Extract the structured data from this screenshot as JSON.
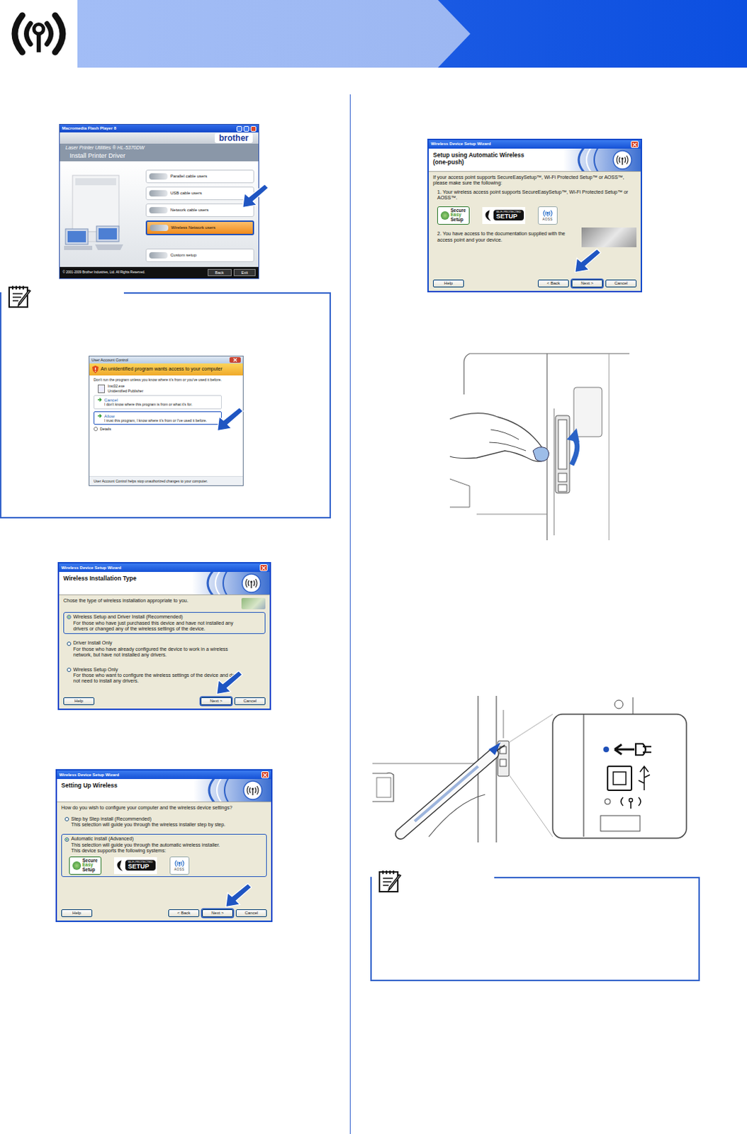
{
  "installer": {
    "title": "Macromedia Flash Player 8",
    "brand": "brother",
    "product": "Laser Printer Utilities ® HL-5370DW",
    "heading": "Install Printer Driver",
    "options": [
      {
        "label": "Parallel cable users",
        "kind": "connection",
        "selected": false
      },
      {
        "label": "USB cable users",
        "kind": "connection",
        "selected": false
      },
      {
        "label": "Network cable users",
        "kind": "connection",
        "selected": false
      },
      {
        "label": "Wireless Network users",
        "kind": "connection",
        "selected": true
      },
      {
        "label": "Custom setup",
        "kind": "custom",
        "selected": false
      }
    ],
    "copyright": "© 2001-2009 Brother Industries, Ltd. All Rights Reserved.",
    "buttons": [
      "Back",
      "Exit"
    ]
  },
  "uac_note": {
    "title": "User Account Control",
    "warning": "An unidentified program wants access to your computer",
    "intro": "Don't run the program unless you know where it's from or you've used it before.",
    "program": "Inst32.exe",
    "publisher": "Unidentified Publisher",
    "choices": [
      {
        "label": "Cancel",
        "detail": "I don't know where this program is from or what it's for.",
        "selected": false
      },
      {
        "label": "Allow",
        "detail": "I trust this program, I know where it's from or I've used it before.",
        "selected": true
      }
    ],
    "details": "Details",
    "footer": "User Account Control helps stop unauthorized changes to your computer."
  },
  "install_type": {
    "window_title": "Wireless Device Setup Wizard",
    "heading": [
      "Wireless Installation Type"
    ],
    "prompt": "Chose the type of wireless installation appropriate to you.",
    "options": [
      {
        "label": "Wireless Setup and Driver Install (Recommended)",
        "detail": [
          "For those who have just purchased this device and have not installed any drivers or changed any of the wireless settings of the device."
        ],
        "selected": true
      },
      {
        "label": "Driver Install Only",
        "detail": [
          "For those who have already configured the device to work in a wireless network, but have not installed any drivers."
        ],
        "selected": false
      },
      {
        "label": "Wireless Setup Only",
        "detail": [
          "For those who want to configure the wireless settings of the device and do not need to install any drivers."
        ],
        "selected": false
      }
    ],
    "help": "Help",
    "buttons": [
      {
        "label": "Next >",
        "focused": true
      },
      {
        "label": "Cancel",
        "focused": false
      }
    ]
  },
  "setting_up": {
    "window_title": "Wireless Device Setup Wizard",
    "heading": [
      "Setting Up Wireless"
    ],
    "prompt": "How do you wish to configure your computer and the wireless device settings?",
    "options": [
      {
        "label": "Step by Step install (Recommended)",
        "detail": [
          "This selection will guide you through the wireless installer step by step."
        ],
        "selected": false
      },
      {
        "label": "Automatic install (Advanced)",
        "detail": [
          "This selection will guide you through the automatic wireless installer.",
          "This device supports the following systems:"
        ],
        "selected": true,
        "logos": [
          {
            "kind": "ses",
            "lines": [
              "Secure",
              "Easy",
              "Setup"
            ]
          },
          {
            "kind": "wps",
            "lines": [
              "Wi-Fi PROTECTED",
              "SETUP"
            ]
          },
          {
            "kind": "aoss",
            "lines": [
              "AOSS"
            ]
          }
        ]
      }
    ],
    "help": "Help",
    "buttons": [
      {
        "label": "< Back",
        "focused": false
      },
      {
        "label": "Next >",
        "focused": true
      },
      {
        "label": "Cancel",
        "focused": false
      }
    ]
  },
  "one_push": {
    "window_title": "Wireless Device Setup Wizard",
    "heading": [
      "Setup using Automatic Wireless",
      "(one-push)"
    ],
    "intro": "If your access point supports SecureEasySetup™, Wi-Fi Protected Setup™ or AOSS™, please make sure the following:",
    "items": [
      "1. Your wireless access point supports SecureEasySetup™, Wi-Fi Protected Setup™ or AOSS™.",
      "2. You have access to the documentation supplied with the access point and your device."
    ],
    "logos": [
      {
        "kind": "ses",
        "lines": [
          "Secure",
          "Easy",
          "Setup"
        ]
      },
      {
        "kind": "wps",
        "lines": [
          "Wi-Fi PROTECTED",
          "SETUP"
        ]
      },
      {
        "kind": "aoss",
        "lines": [
          "AOSS"
        ]
      }
    ],
    "help": "Help",
    "buttons": [
      {
        "label": "< Back",
        "focused": false
      },
      {
        "label": "Next >",
        "focused": true
      },
      {
        "label": "Cancel",
        "focused": false
      }
    ]
  }
}
